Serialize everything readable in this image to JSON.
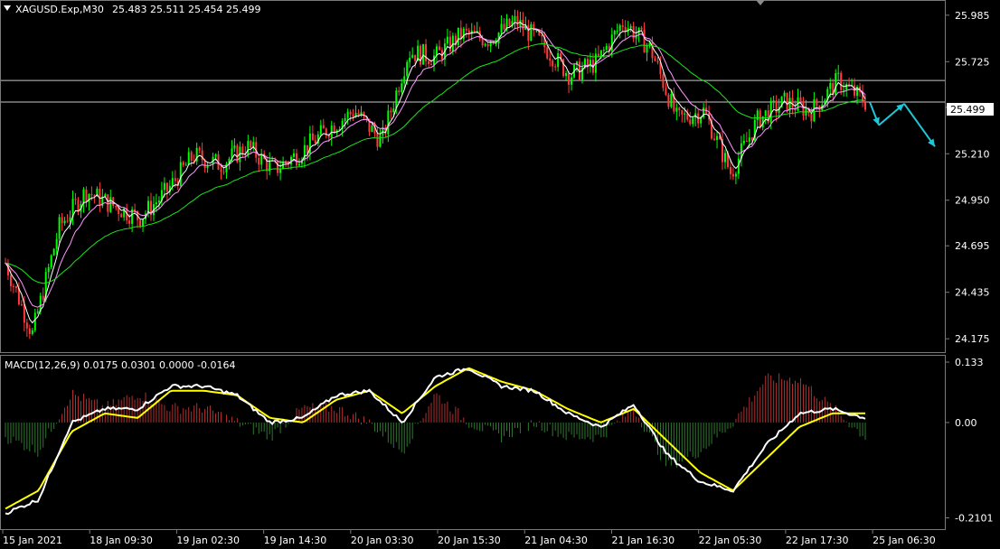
{
  "header": {
    "symbol": "XAGUSD.Exp,M30",
    "ohlc": "25.483 25.511 25.454 25.499",
    "menu_icon": "triangle-down-icon"
  },
  "macd_header": "MACD(12,26,9) 0.0175 0.0301 0.0000 -0.0164",
  "price_badge": "25.499",
  "colors": {
    "background": "#000000",
    "bull": "#00ff00",
    "bear": "#ff3b3b",
    "ma_fast": "#ffffff",
    "ma_mid": "#ff99ff",
    "ma_slow": "#19e619",
    "hline": "#c8c8c8",
    "arrow": "#1ec8d8",
    "macd_main": "#ffffff",
    "macd_signal": "#ffff00",
    "hist_pos": "#b03030",
    "hist_neg": "#2e7a2e"
  },
  "chart_data": {
    "type": "candlestick",
    "price_axis_ticks": [
      "25.985",
      "25.725",
      "25.470",
      "25.210",
      "24.950",
      "24.695",
      "24.435",
      "24.175"
    ],
    "price_tick_values": [
      25.985,
      25.725,
      25.47,
      25.21,
      24.95,
      24.695,
      24.435,
      24.175
    ],
    "price_range": [
      24.1,
      26.06
    ],
    "horizontal_lines": [
      25.62,
      25.499
    ],
    "macd_axis_ticks": [
      "0.133",
      "0.00",
      "-0.2101"
    ],
    "macd_tick_values": [
      0.133,
      0.0,
      -0.2101
    ],
    "macd_range": [
      -0.235,
      0.145
    ],
    "time_axis_labels": [
      "15 Jan 2021",
      "18 Jan 09:30",
      "19 Jan 02:30",
      "19 Jan 14:30",
      "20 Jan 03:30",
      "20 Jan 15:30",
      "21 Jan 04:30",
      "21 Jan 16:30",
      "22 Jan 05:30",
      "22 Jan 17:30",
      "25 Jan 06:30"
    ],
    "price_path": [
      24.6,
      24.2,
      24.8,
      25.0,
      24.92,
      24.85,
      25.0,
      25.2,
      25.15,
      25.25,
      25.12,
      25.22,
      25.35,
      25.45,
      25.28,
      25.78,
      25.75,
      25.88,
      25.85,
      25.95,
      25.82,
      25.65,
      25.72,
      25.95,
      25.8,
      25.4,
      25.45,
      25.1,
      25.4,
      25.5,
      25.45,
      25.62,
      25.5
    ],
    "macd_main_path": [
      -0.2,
      -0.17,
      0.0,
      0.03,
      0.03,
      0.08,
      0.08,
      0.06,
      0.0,
      0.01,
      0.06,
      0.07,
      0.0,
      0.1,
      0.12,
      0.08,
      0.07,
      0.02,
      -0.01,
      0.04,
      -0.07,
      -0.13,
      -0.15,
      -0.05,
      0.02,
      0.03,
      0.01
    ],
    "macd_signal_path": [
      -0.19,
      -0.15,
      -0.02,
      0.02,
      0.01,
      0.07,
      0.07,
      0.06,
      0.01,
      0.0,
      0.05,
      0.07,
      0.02,
      0.08,
      0.12,
      0.09,
      0.07,
      0.03,
      0.0,
      0.03,
      -0.04,
      -0.11,
      -0.15,
      -0.08,
      -0.01,
      0.02,
      0.02
    ],
    "forecast_arrows": [
      [
        25.499,
        25.37
      ],
      [
        25.37,
        25.49
      ],
      [
        25.49,
        25.25
      ]
    ]
  }
}
